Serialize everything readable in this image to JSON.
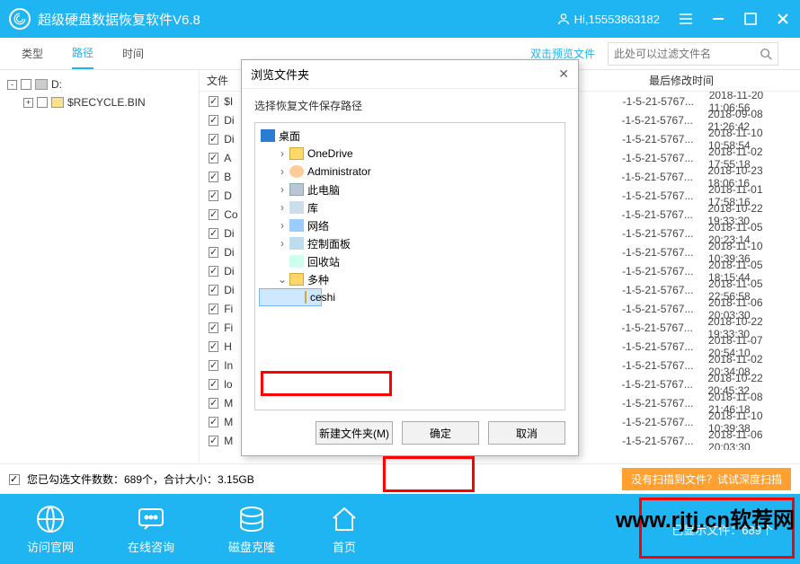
{
  "title": "超级硬盘数据恢复软件V6.8",
  "user": "Hi,15553863182",
  "tabs": {
    "type": "类型",
    "path": "路径",
    "time": "时间"
  },
  "tabs_right": "双击预览文件",
  "search_placeholder": "此处可以过滤文件名",
  "tree": {
    "drive": "D:",
    "recycle": "$RECYCLE.BIN"
  },
  "columns": {
    "name": "文件",
    "date": "最后修改时间"
  },
  "rows": [
    {
      "n": "$I",
      "i": "-1-5-21-5767...",
      "d": "2018-11-20 11:06:56"
    },
    {
      "n": "Di",
      "i": "-1-5-21-5767...",
      "d": "2018-09-08 21:26:42"
    },
    {
      "n": "Di",
      "i": "-1-5-21-5767...",
      "d": "2018-11-10 10:58:54"
    },
    {
      "n": "A",
      "i": "-1-5-21-5767...",
      "d": "2018-11-02 17:55:18"
    },
    {
      "n": "B",
      "i": "-1-5-21-5767...",
      "d": "2018-10-23 18:06:16"
    },
    {
      "n": "D",
      "i": "-1-5-21-5767...",
      "d": "2018-11-01 17:58:16"
    },
    {
      "n": "Co",
      "i": "-1-5-21-5767...",
      "d": "2018-10-22 19:33:30"
    },
    {
      "n": "Di",
      "i": "-1-5-21-5767...",
      "d": "2018-11-05 20:23:14"
    },
    {
      "n": "Di",
      "i": "-1-5-21-5767...",
      "d": "2018-11-10 10:39:36"
    },
    {
      "n": "Di",
      "i": "-1-5-21-5767...",
      "d": "2018-11-05 18:15:44"
    },
    {
      "n": "Di",
      "i": "-1-5-21-5767...",
      "d": "2018-11-05 22:56:58"
    },
    {
      "n": "Fi",
      "i": "-1-5-21-5767...",
      "d": "2018-11-06 20:03:30"
    },
    {
      "n": "Fi",
      "i": "-1-5-21-5767...",
      "d": "2018-10-22 19:33:30"
    },
    {
      "n": "H",
      "i": "-1-5-21-5767...",
      "d": "2018-11-07 20:54:10"
    },
    {
      "n": "In",
      "i": "-1-5-21-5767...",
      "d": "2018-11-02 20:34:08"
    },
    {
      "n": "lo",
      "i": "-1-5-21-5767...",
      "d": "2018-10-22 20:45:32"
    },
    {
      "n": "M",
      "i": "-1-5-21-5767...",
      "d": "2018-11-08 21:46:18"
    },
    {
      "n": "M",
      "i": "-1-5-21-5767...",
      "d": "2018-11-10 10:39:38"
    },
    {
      "n": "M",
      "i": "-1-5-21-5767...",
      "d": "2018-11-06 20:03:30"
    }
  ],
  "summary": "您已勾选文件数数：689个，合计大小：3.15GB",
  "deep_scan": "没有扫描到文件？试试深度扫描",
  "footer": {
    "site": "访问官网",
    "chat": "在线咨询",
    "clone": "磁盘克隆",
    "home": "首页",
    "shown": "已显示文件：689个"
  },
  "watermark": "www.rjtj.cn软荐网",
  "dialog": {
    "title": "浏览文件夹",
    "subtitle": "选择恢复文件保存路径",
    "nodes": {
      "desktop": "桌面",
      "onedrive": "OneDrive",
      "admin": "Administrator",
      "pc": "此电脑",
      "lib": "库",
      "net": "网络",
      "ctrl": "控制面板",
      "bin": "回收站",
      "many": "多种",
      "ceshi": "ceshi"
    },
    "new_folder": "新建文件夹(M)",
    "ok": "确定",
    "cancel": "取消"
  }
}
